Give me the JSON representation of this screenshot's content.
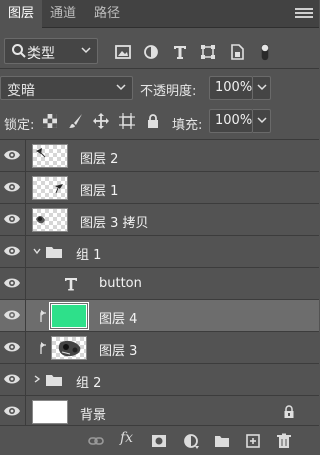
{
  "tabs": [
    {
      "label": "图层",
      "active": true
    },
    {
      "label": "通道",
      "active": false
    },
    {
      "label": "路径",
      "active": false
    }
  ],
  "filter": {
    "kind_label": "类型"
  },
  "blend": {
    "mode": "变暗",
    "opacity_label": "不透明度:",
    "opacity_value": "100%"
  },
  "lock": {
    "label": "锁定:",
    "fill_label": "填充:",
    "fill_value": "100%"
  },
  "layers": [
    {
      "name": "图层 2"
    },
    {
      "name": "图层 1"
    },
    {
      "name": "图层 3 拷贝"
    },
    {
      "name": "组 1"
    },
    {
      "name": "button"
    },
    {
      "name": "图层 4"
    },
    {
      "name": "图层 3"
    },
    {
      "name": "组 2"
    },
    {
      "name": "背景"
    }
  ],
  "bottom": {
    "fx_label": "fx"
  },
  "colors": {
    "panel": "#535353",
    "selected": "#6d6d6d",
    "thumb_green": "#2ee08a"
  }
}
